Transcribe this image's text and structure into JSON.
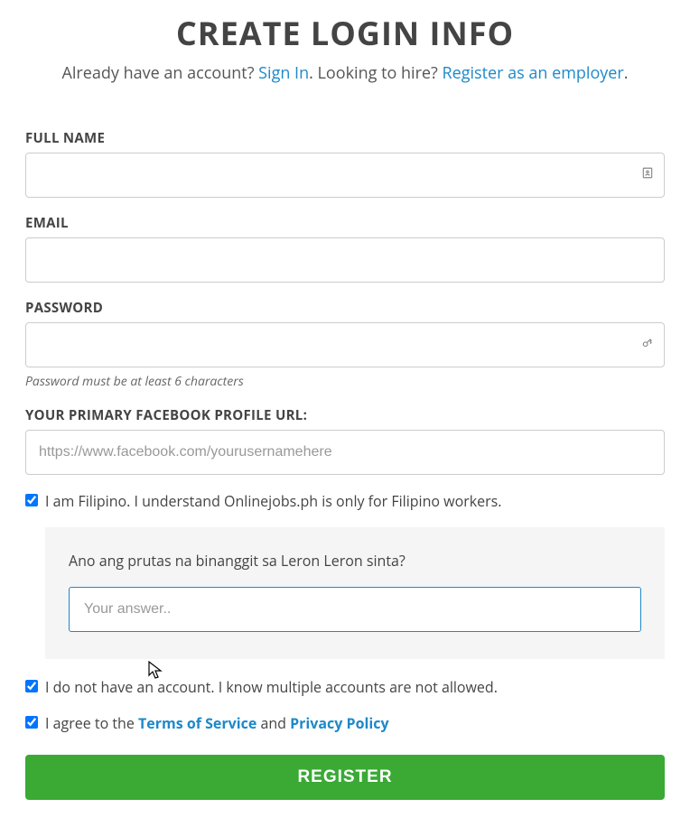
{
  "title": "CREATE LOGIN INFO",
  "subline": {
    "pre_signin": "Already have an account? ",
    "signin": "Sign In",
    "mid": ". Looking to hire? ",
    "employer": "Register as an employer",
    "post": "."
  },
  "fields": {
    "fullname": {
      "label": "FULL NAME"
    },
    "email": {
      "label": "EMAIL"
    },
    "password": {
      "label": "PASSWORD",
      "helper": "Password must be at least 6 characters"
    },
    "facebook": {
      "label": "YOUR PRIMARY FACEBOOK PROFILE URL:",
      "placeholder": "https://www.facebook.com/yourusernamehere"
    }
  },
  "checkboxes": {
    "filipino": "I am Filipino. I understand Onlinejobs.ph is only for Filipino workers.",
    "noaccount": "I do not have an account. I know multiple accounts are not allowed.",
    "agree_prefix": "I agree to the ",
    "tos": "Terms of Service",
    "agree_mid": " and ",
    "privacy": "Privacy Policy"
  },
  "security": {
    "question": "Ano ang prutas na binanggit sa Leron Leron sinta?",
    "placeholder": "Your answer.."
  },
  "register_label": "REGISTER"
}
